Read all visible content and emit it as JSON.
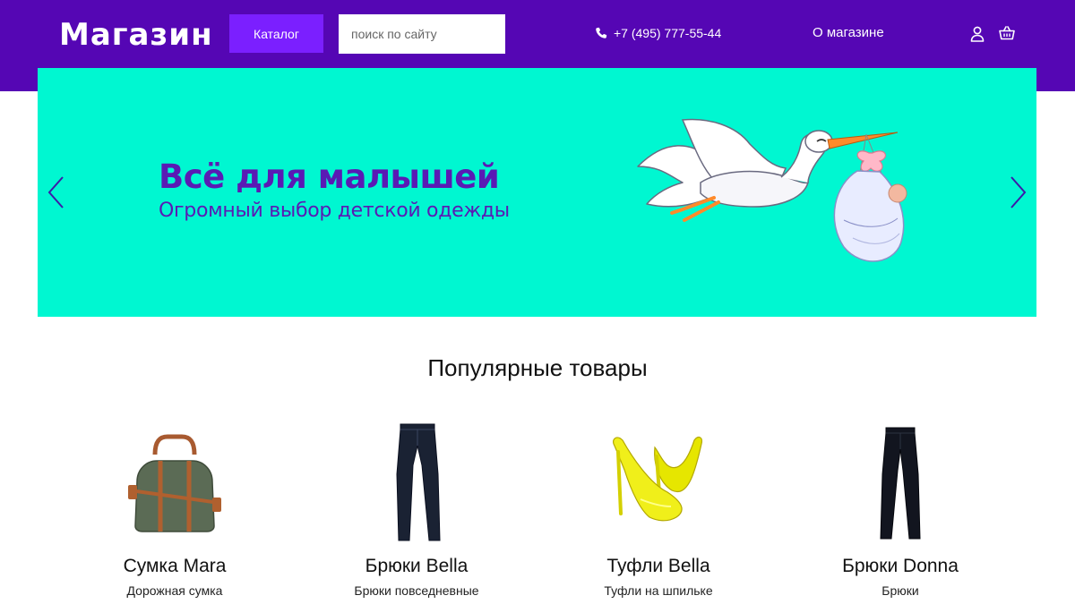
{
  "header": {
    "logo": "Магазин",
    "catalog_label": "Каталог",
    "search_placeholder": "поиск по сайту",
    "search_value": "",
    "phone": "+7 (495) 777-55-44",
    "about_label": "О магазине",
    "icons": [
      "phone-icon",
      "user-icon",
      "cart-icon"
    ]
  },
  "banner": {
    "title": "Всё для малышей",
    "subtitle": "Огромный выбор детской одежды",
    "prev_icon": "chevron-left-icon",
    "next_icon": "chevron-right-icon"
  },
  "section": {
    "title": "Популярные товары"
  },
  "products": [
    {
      "name": "Сумка Mara",
      "desc": "Дорожная сумка",
      "image": "bag"
    },
    {
      "name": "Брюки Bella",
      "desc": "Брюки повседневные",
      "image": "jeans"
    },
    {
      "name": "Туфли Bella",
      "desc": "Туфли на шпильке",
      "image": "heels"
    },
    {
      "name": "Брюки Donna",
      "desc": "Брюки",
      "image": "trousers"
    }
  ],
  "colors": {
    "header_bg": "#5506b4",
    "catalog_btn": "#7b1fff",
    "banner_bg": "#00f7d1",
    "banner_text": "#5a1ab4"
  }
}
